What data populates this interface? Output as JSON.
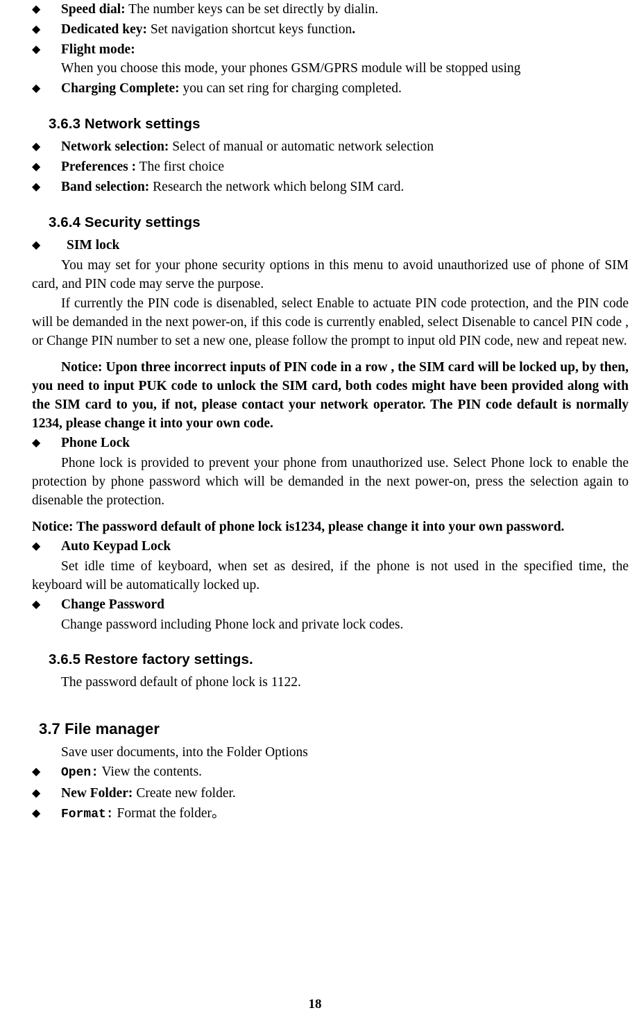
{
  "page": {
    "number": "18"
  },
  "bullet_glyph": "◆",
  "items_top": [
    {
      "label": "Speed dial:",
      "text": " The number keys can be set directly by dialin."
    },
    {
      "label": "Dedicated key:",
      "text": " Set navigation shortcut keys function",
      "tail_bold": "."
    },
    {
      "label": "Flight  mode:",
      "text": " When  you  choose  this  mode,    your  phones  GSM/GPRS  module  will  be stopped using"
    },
    {
      "label": "Charging Complete:",
      "text": " you can set ring for charging completed."
    }
  ],
  "section_network": {
    "heading": "3.6.3 Network settings",
    "items": [
      {
        "label": "Network selection:",
        "text": " Select of manual or automatic network selection"
      },
      {
        "label": "Preferences :",
        "text": " The first choice"
      },
      {
        "label": "Band selection:",
        "text": " Research the network which belong SIM card."
      }
    ]
  },
  "section_security": {
    "heading": "3.6.4 Security settings",
    "sim_lock_label": "SIM lock",
    "paragraph1": "You may set for your phone security options in this menu to avoid unauthorized use of phone of SIM card, and PIN code may serve the purpose.",
    "paragraph2": "If currently the PIN code is disenabled, select Enable to actuate PIN code protection, and the PIN  code  will  be  demanded  in  the  next  power-on,  if  this  code  is  currently  enabled,  select Disenable to cancel PIN code , or Change PIN number to set a new one, please follow the prompt to input old PIN code, new and repeat new.",
    "notice1": "Notice: Upon three incorrect inputs of PIN code in a row , the SIM card will be locked up, by then, you need to input PUK code to unlock the SIM card, both codes might have been provided along with the SIM card to you, if not, please contact your network operator. The PIN code default is normally 1234, please change it into your own code.",
    "phone_lock_label": "Phone Lock",
    "phone_lock_text": "Phone lock is provided to prevent your phone from unauthorized use. Select Phone lock to enable the protection by phone password which will be demanded in the next power-on, press the selection again to disenable the protection.",
    "notice2": "Notice: The password default of phone lock is1234, please change it into your own password.",
    "auto_keypad_label": "Auto Keypad Lock",
    "auto_keypad_text": "Set idle time of keyboard, when set as desired, if the phone is not used in the specified time, the keyboard will be automatically locked up.",
    "change_password_label": "Change Password",
    "change_password_text": "Change password including Phone lock and private lock codes."
  },
  "section_restore": {
    "heading": "3.6.5 Restore factory settings.",
    "text": "The password default of phone lock is 1122."
  },
  "section_file_manager": {
    "heading": "3.7 File manager",
    "intro": "Save user documents, into the Folder Options",
    "items": [
      {
        "label": "Open:",
        "text": "  View the contents.",
        "mono": true
      },
      {
        "label": "New Folder:",
        "text": " Create new folder.",
        "mono": false
      },
      {
        "label": "Format:",
        "text": " Format the folder。",
        "mono": true
      }
    ]
  }
}
